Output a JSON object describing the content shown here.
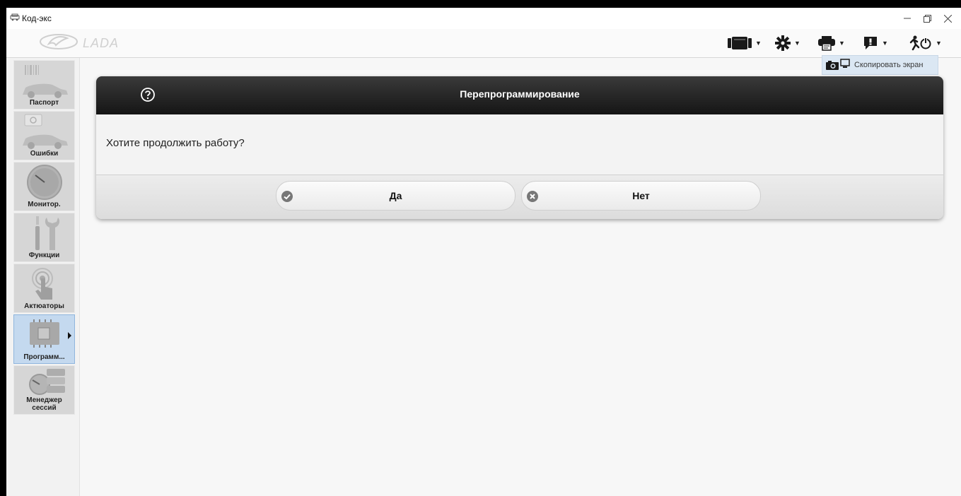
{
  "window": {
    "title": "Код-экс",
    "icons": [
      "app-car-icon",
      "minimize-icon",
      "restore-icon",
      "close-icon"
    ]
  },
  "header": {
    "brand": "LADA",
    "toolbar": [
      {
        "name": "connection-icon"
      },
      {
        "name": "settings-gear-icon"
      },
      {
        "name": "printer-icon"
      },
      {
        "name": "info-icon"
      },
      {
        "name": "exit-runner-icon"
      }
    ],
    "dropdown_item": "Скопировать экран"
  },
  "sidebar": {
    "items": [
      {
        "label": "Паспорт",
        "icon": "passport-car-icon"
      },
      {
        "label": "Ошибки",
        "icon": "errors-car-icon"
      },
      {
        "label": "Монитор.",
        "icon": "gauge-icon"
      },
      {
        "label": "Функции",
        "icon": "wrench-icon"
      },
      {
        "label": "Актюаторы",
        "icon": "touch-hand-icon"
      },
      {
        "label": "Программ...",
        "icon": "chip-programming-icon"
      },
      {
        "label_line1": "Менеджер",
        "label_line2": "сессий",
        "icon": "session-manager-icon"
      }
    ],
    "active_index": 5
  },
  "dialog": {
    "title": "Перепрограммирование",
    "message": "Хотите продолжить работу?",
    "yes_label": "Да",
    "no_label": "Нет"
  },
  "colors": {
    "dialog_header": "#1f1f1f",
    "active_sidebar": "#c4d9ef",
    "tooltip_bg": "#dbe7f3"
  }
}
